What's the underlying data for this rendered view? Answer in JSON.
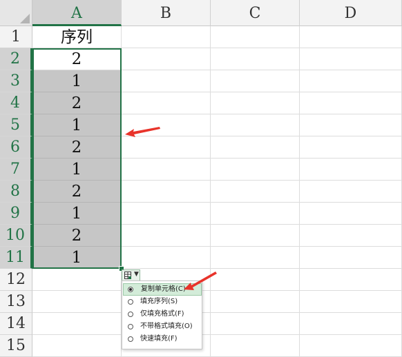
{
  "columns": [
    "A",
    "B",
    "C",
    "D"
  ],
  "rows": [
    "1",
    "2",
    "3",
    "4",
    "5",
    "6",
    "7",
    "8",
    "9",
    "10",
    "11",
    "12",
    "13",
    "14",
    "15"
  ],
  "cells": {
    "A1": "序列",
    "A2": "2",
    "A3": "1",
    "A4": "2",
    "A5": "1",
    "A6": "2",
    "A7": "1",
    "A8": "2",
    "A9": "1",
    "A10": "2",
    "A11": "1"
  },
  "selection": "A2:A11",
  "autofill_menu": {
    "items": [
      {
        "label": "复制单元格(C)",
        "selected": true
      },
      {
        "label": "填充序列(S)",
        "selected": false
      },
      {
        "label": "仅填充格式(F)",
        "selected": false
      },
      {
        "label": "不带格式填充(O)",
        "selected": false
      },
      {
        "label": "快速填充(F)",
        "selected": false
      }
    ]
  },
  "colors": {
    "accent": "#217346",
    "selection_fill": "#c6c6c6",
    "annotation_arrow": "#e8332a"
  }
}
